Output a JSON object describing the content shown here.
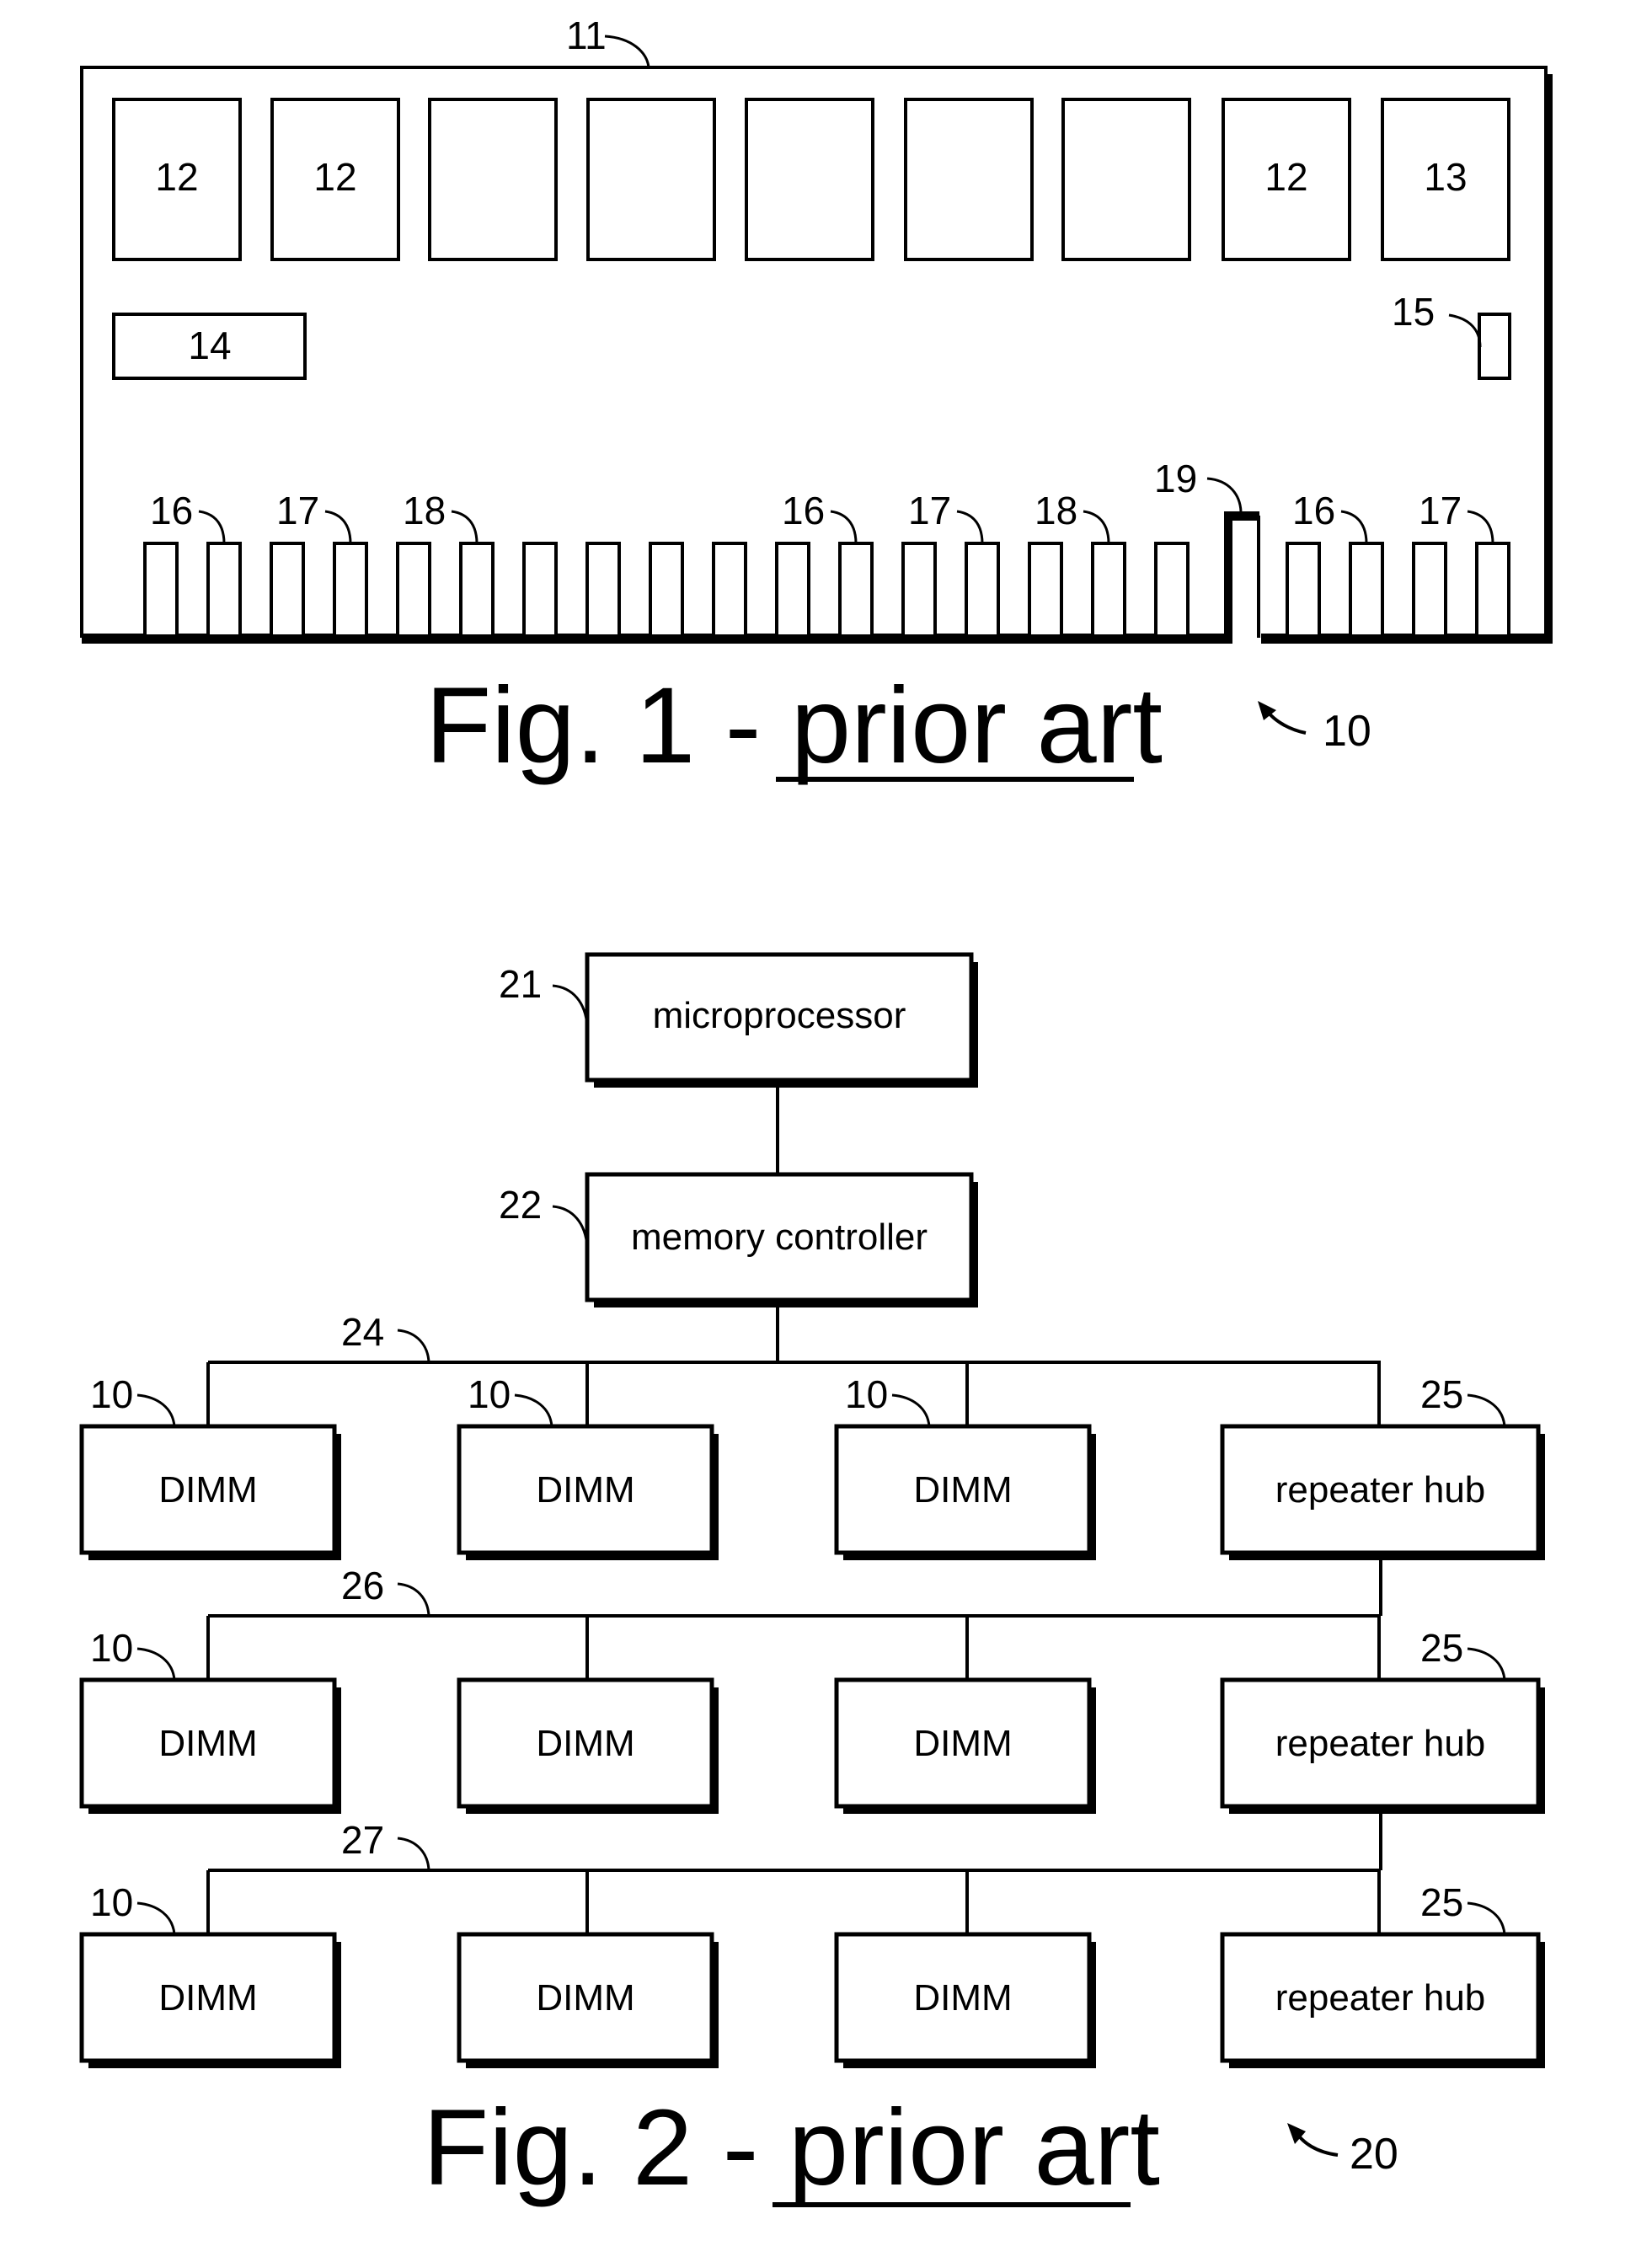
{
  "colors": {
    "ink": "#000000",
    "paper": "#ffffff"
  },
  "fig1": {
    "caption_prefix": "Fig. 1 - ",
    "caption_emph": "prior art",
    "assembly_ref": "10",
    "board_ref": "11",
    "chips": [
      {
        "label": "12"
      },
      {
        "label": "12"
      },
      {
        "label": ""
      },
      {
        "label": ""
      },
      {
        "label": ""
      },
      {
        "label": ""
      },
      {
        "label": ""
      },
      {
        "label": "12"
      },
      {
        "label": "13"
      }
    ],
    "component_14": "14",
    "component_15_ref": "15",
    "pin_refs": [
      {
        "label": "16",
        "pin": 1
      },
      {
        "label": "17",
        "pin": 3
      },
      {
        "label": "18",
        "pin": 5
      },
      {
        "label": "16",
        "pin": 11
      },
      {
        "label": "17",
        "pin": 13
      },
      {
        "label": "18",
        "pin": 15
      },
      {
        "label": "16",
        "pin": 18
      },
      {
        "label": "17",
        "pin": 20
      }
    ],
    "notch_ref": "19",
    "pins_left_count": 17,
    "pins_right_count": 4
  },
  "fig2": {
    "caption_prefix": "Fig. 2 - ",
    "caption_emph": "prior art",
    "system_ref": "20",
    "microprocessor": {
      "ref": "21",
      "label": "microprocessor"
    },
    "memory_controller": {
      "ref": "22",
      "label": "memory controller"
    },
    "rows": [
      {
        "bus_ref": "24",
        "modules": [
          {
            "label": "DIMM",
            "ref": "10"
          },
          {
            "label": "DIMM",
            "ref": "10"
          },
          {
            "label": "DIMM",
            "ref": "10"
          },
          {
            "label": "repeater hub",
            "ref": "25"
          }
        ]
      },
      {
        "bus_ref": "26",
        "modules": [
          {
            "label": "DIMM",
            "ref": "10"
          },
          {
            "label": "DIMM",
            "ref": ""
          },
          {
            "label": "DIMM",
            "ref": ""
          },
          {
            "label": "repeater hub",
            "ref": "25"
          }
        ]
      },
      {
        "bus_ref": "27",
        "modules": [
          {
            "label": "DIMM",
            "ref": "10"
          },
          {
            "label": "DIMM",
            "ref": ""
          },
          {
            "label": "DIMM",
            "ref": ""
          },
          {
            "label": "repeater hub",
            "ref": "25"
          }
        ]
      }
    ]
  }
}
